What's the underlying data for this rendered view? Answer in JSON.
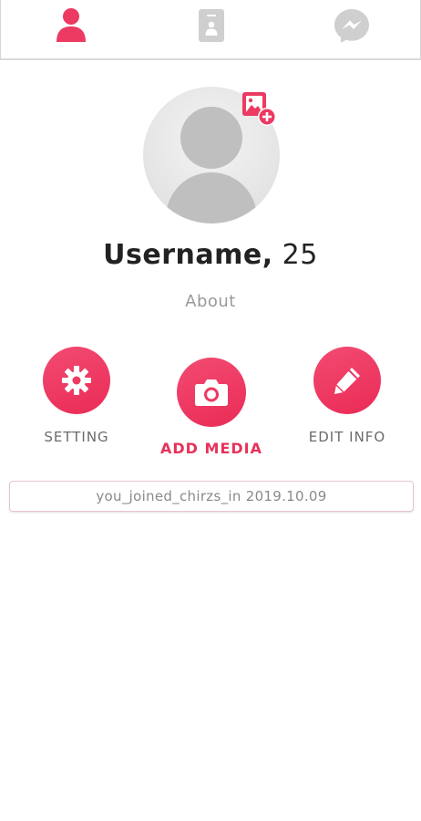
{
  "nav": {
    "tabs": [
      {
        "name": "profile",
        "icon": "person-icon",
        "active": true
      },
      {
        "name": "cards",
        "icon": "card-icon",
        "active": false
      },
      {
        "name": "messages",
        "icon": "messenger-icon",
        "active": false
      }
    ]
  },
  "profile": {
    "name": "Username,",
    "age": "25",
    "about": "About"
  },
  "actions": {
    "setting_label": "SETTING",
    "add_media_label": "ADD MEDIA",
    "edit_info_label": "EDIT INFO"
  },
  "joined_text": "you_joined_chirzs_in 2019.10.09",
  "colors": {
    "accent": "#ea2b56",
    "inactive_icon": "#cfcfcf",
    "placeholder": "#bfbfbf"
  }
}
